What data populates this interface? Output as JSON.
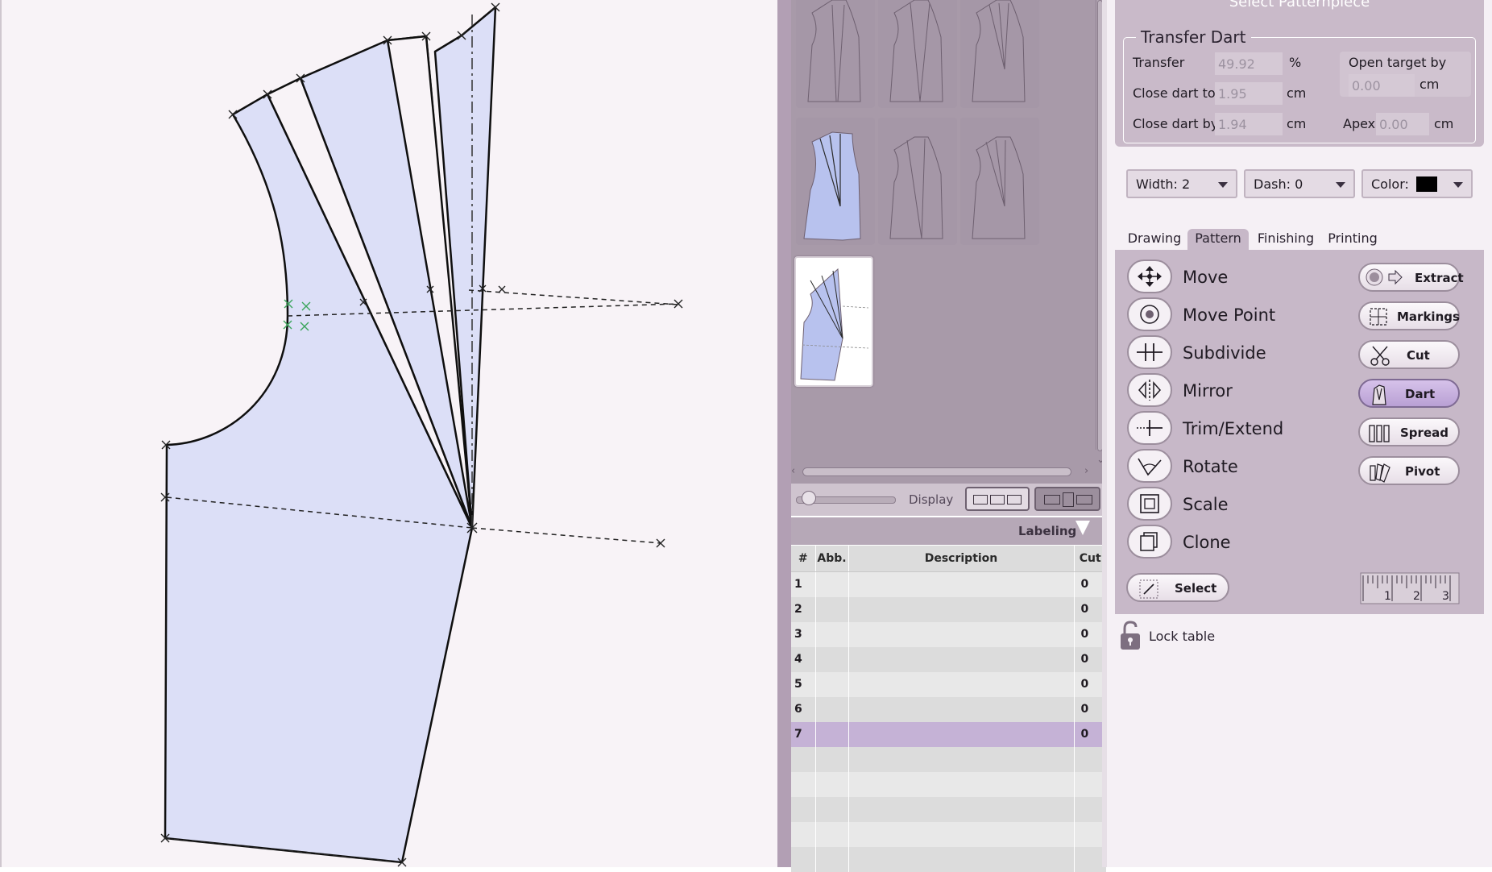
{
  "right_panel": {
    "title": "Select Patternpiece",
    "transfer_dart": {
      "legend": "Transfer Dart",
      "transfer_label": "Transfer",
      "transfer_value": "49.92",
      "transfer_unit": "%",
      "close_to_label": "Close dart to",
      "close_to_value": "1.95",
      "close_to_unit": "cm",
      "close_by_label": "Close dart by",
      "close_by_value": "1.94",
      "close_by_unit": "cm",
      "open_target_label": "Open target by",
      "open_target_value": "0.00",
      "open_target_unit": "cm",
      "apex_label": "Apex",
      "apex_value": "0.00",
      "apex_unit": "cm"
    },
    "line_style": {
      "width_label": "Width:  2",
      "dash_label": "Dash:  0",
      "color_label": "Color:",
      "color_value": "#000000"
    },
    "tabs": [
      "Drawing",
      "Pattern",
      "Finishing",
      "Printing"
    ],
    "active_tab": "Pattern",
    "tools": [
      "Move",
      "Move Point",
      "Subdivide",
      "Mirror",
      "Trim/Extend",
      "Rotate",
      "Scale",
      "Clone"
    ],
    "pattern_buttons": [
      "Extract",
      "Markings",
      "Cut",
      "Dart",
      "Spread",
      "Pivot"
    ],
    "active_pattern_button": "Dart",
    "select_label": "Select",
    "ruler_ticks": [
      "1",
      "2",
      "3"
    ],
    "lock_label": "Lock table"
  },
  "middle_panel": {
    "display_label": "Display",
    "labeling_title": "Labeling",
    "table_headers": [
      "#",
      "Abb.",
      "Description",
      "Cut"
    ],
    "rows": [
      {
        "num": "1",
        "abb": "",
        "desc": "",
        "cut": "0"
      },
      {
        "num": "2",
        "abb": "",
        "desc": "",
        "cut": "0"
      },
      {
        "num": "3",
        "abb": "",
        "desc": "",
        "cut": "0"
      },
      {
        "num": "4",
        "abb": "",
        "desc": "",
        "cut": "0"
      },
      {
        "num": "5",
        "abb": "",
        "desc": "",
        "cut": "0"
      },
      {
        "num": "6",
        "abb": "",
        "desc": "",
        "cut": "0"
      },
      {
        "num": "7",
        "abb": "",
        "desc": "",
        "cut": "0"
      },
      {
        "num": "",
        "abb": "",
        "desc": "",
        "cut": ""
      },
      {
        "num": "",
        "abb": "",
        "desc": "",
        "cut": ""
      },
      {
        "num": "",
        "abb": "",
        "desc": "",
        "cut": ""
      },
      {
        "num": "",
        "abb": "",
        "desc": "",
        "cut": ""
      },
      {
        "num": "",
        "abb": "",
        "desc": "",
        "cut": ""
      }
    ],
    "selected_row": "7"
  },
  "colors": {
    "pattern_fill": "#dcdff7",
    "selection_purple": "#c5b2d6",
    "panel_mauve": "#c9bac9"
  }
}
